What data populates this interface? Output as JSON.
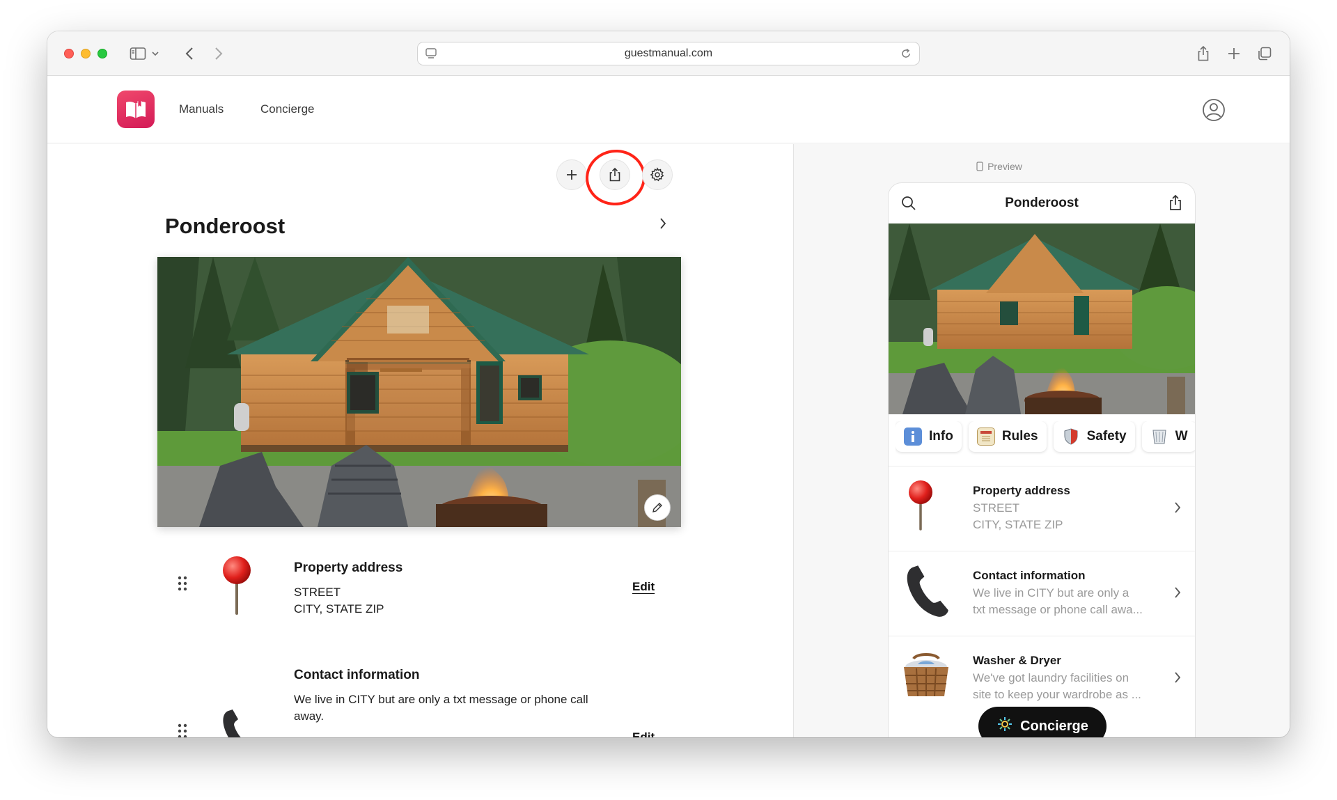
{
  "browser": {
    "url": "guestmanual.com"
  },
  "nav": {
    "items": [
      {
        "label": "Manuals"
      },
      {
        "label": "Concierge"
      }
    ]
  },
  "editor": {
    "title": "Ponderoost",
    "items": [
      {
        "title": "Property address",
        "lines": [
          "STREET",
          "CITY, STATE ZIP"
        ],
        "edit_label": "Edit",
        "icon": "pushpin-icon"
      },
      {
        "title": "Contact information",
        "lines": [
          "We live in CITY but are only a txt message or phone call",
          "away."
        ],
        "edit_label": "Edit",
        "icon": "telephone-icon"
      }
    ]
  },
  "preview": {
    "label": "Preview",
    "phone_title": "Ponderoost",
    "chips": [
      {
        "label": "Info",
        "icon": "info-icon"
      },
      {
        "label": "Rules",
        "icon": "notepad-icon"
      },
      {
        "label": "Safety",
        "icon": "shield-icon"
      },
      {
        "label": "W",
        "icon": "wastebasket-icon"
      }
    ],
    "items": [
      {
        "title": "Property address",
        "lines": [
          "STREET",
          "CITY, STATE ZIP"
        ],
        "icon": "pushpin-icon"
      },
      {
        "title": "Contact information",
        "lines": [
          "We live in CITY but are only a",
          "txt message or phone call awa..."
        ],
        "icon": "telephone-icon"
      },
      {
        "title": "Washer & Dryer",
        "lines": [
          "We've got laundry facilities on",
          "site to keep your wardrobe as ..."
        ],
        "icon": "laundry-basket-icon"
      }
    ],
    "concierge_label": "Concierge"
  },
  "colors": {
    "brand": "#e02b5f",
    "highlight_ring": "#ff2418",
    "concierge_bg": "#111111"
  }
}
